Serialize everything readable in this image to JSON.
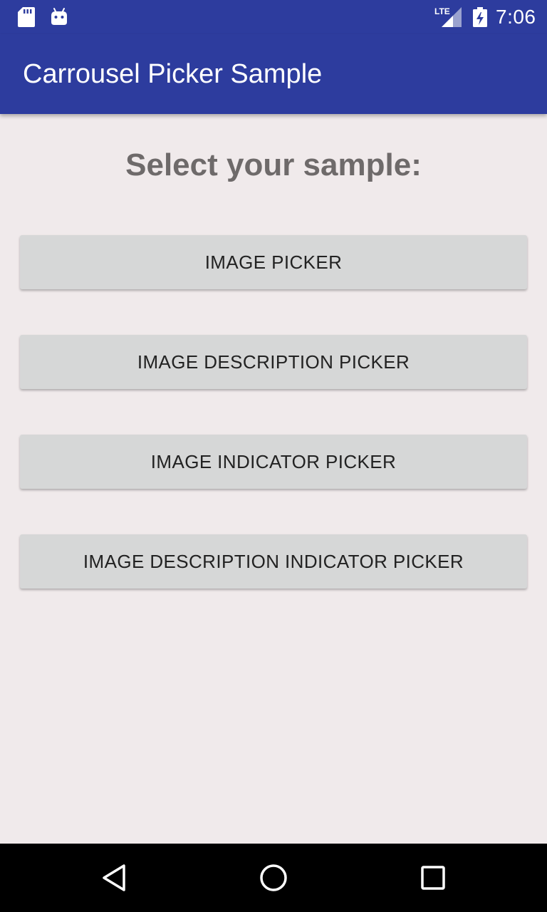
{
  "status_bar": {
    "icons": [
      "sd-card-icon",
      "android-icon",
      "lte-signal-icon",
      "battery-charging-icon"
    ],
    "network_label": "LTE",
    "time": "7:06"
  },
  "app_bar": {
    "title": "Carrousel Picker Sample"
  },
  "main": {
    "heading": "Select your sample:",
    "buttons": [
      {
        "label": "IMAGE PICKER"
      },
      {
        "label": "IMAGE DESCRIPTION PICKER"
      },
      {
        "label": "IMAGE INDICATOR PICKER"
      },
      {
        "label": "IMAGE DESCRIPTION INDICATOR PICKER"
      }
    ]
  },
  "nav_bar": {
    "icons": [
      "back-icon",
      "home-icon",
      "recents-icon"
    ]
  },
  "colors": {
    "primary": "#2d3c9e",
    "background": "#f0eaeb",
    "button": "#d6d7d7",
    "heading_text": "#6e6a6a",
    "button_text": "#222222",
    "nav_bar": "#000000"
  }
}
